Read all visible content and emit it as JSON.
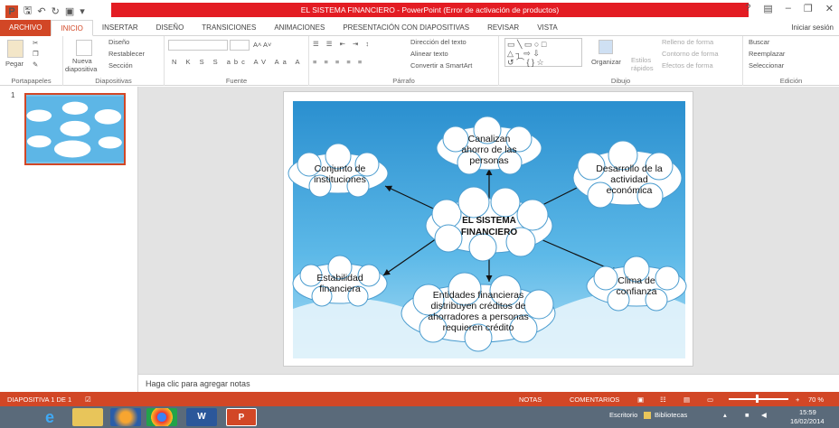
{
  "window": {
    "title": "EL SISTEMA FINANCIERO - PowerPoint (Error de activación de productos)",
    "sign_in": "Iniciar sesión"
  },
  "tabs": [
    "ARCHIVO",
    "INICIO",
    "INSERTAR",
    "DISEÑO",
    "TRANSICIONES",
    "ANIMACIONES",
    "PRESENTACIÓN CON DIAPOSITIVAS",
    "REVISAR",
    "VISTA"
  ],
  "ribbon": {
    "paste": "Pegar",
    "new_slide_1": "Nueva",
    "new_slide_2": "diapositiva",
    "design": "Diseño",
    "reset": "Restablecer",
    "section": "Sección",
    "text_direction": "Dirección del texto",
    "align_text": "Alinear texto",
    "smartart": "Convertir a SmartArt",
    "organize": "Organizar",
    "styles_1": "Estilos",
    "styles_2": "rápidos",
    "shape_fill": "Relleno de forma",
    "shape_outline": "Contorno de forma",
    "shape_effects": "Efectos de forma",
    "find": "Buscar",
    "replace": "Reemplazar",
    "select": "Seleccionar",
    "groups": [
      "Portapapeles",
      "Diapositivas",
      "Fuente",
      "Párrafo",
      "Dibujo",
      "Edición"
    ]
  },
  "slide_number": "1",
  "slide": {
    "center_1": "EL SISTEMA",
    "center_2": "FINANCIERO",
    "top_1": "Canalizan",
    "top_2": "ahorro de las",
    "top_3": "personas",
    "left_top_1": "Conjunto de",
    "left_top_2": "instituciones",
    "right_top_1": "Desarrollo de la",
    "right_top_2": "actividad",
    "right_top_3": "económica",
    "left_bottom_1": "Estabilidad",
    "left_bottom_2": "financiera",
    "right_bottom_1": "Clima de",
    "right_bottom_2": "confianza",
    "bottom_1": "Entidades financieras",
    "bottom_2": "distribuyen créditos de",
    "bottom_3": "ahorradores  a personas",
    "bottom_4": "requieren crédito"
  },
  "notes_placeholder": "Haga clic para agregar notas",
  "status": {
    "slide_info": "DIAPOSITIVA 1 DE 1",
    "notes": "NOTAS",
    "comments": "COMENTARIOS",
    "zoom": "70 %"
  },
  "taskbar": {
    "desktop": "Escritorio",
    "libraries": "Bibliotecas",
    "time": "15:59",
    "date": "16/02/2014"
  },
  "colors": {
    "accent": "#d24726",
    "title_red": "#e31c23",
    "slide_sky": "#3ea3d8"
  }
}
